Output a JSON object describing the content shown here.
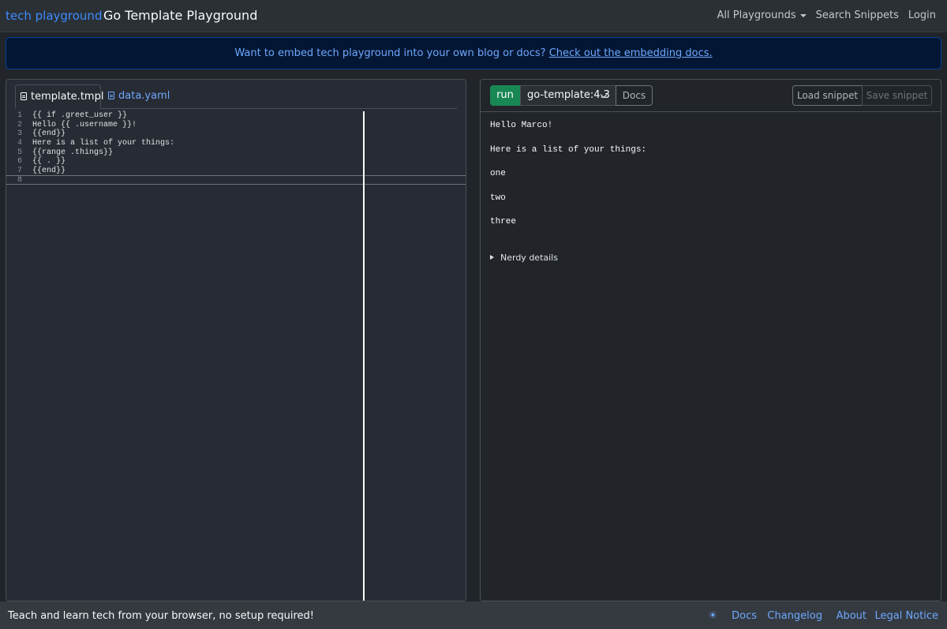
{
  "navbar": {
    "brand": "tech playground",
    "title": "Go Template Playground",
    "menu": {
      "all_playgrounds": "All Playgrounds",
      "search_snippets": "Search Snippets",
      "login": "Login"
    }
  },
  "alert": {
    "text": "Want to embed tech playground into your own blog or docs?",
    "link": "Check out the embedding docs."
  },
  "editor": {
    "tabs": [
      {
        "label": "template.tmpl",
        "active": true,
        "icon": "file-icon"
      },
      {
        "label": "data.yaml",
        "active": false,
        "icon": "file-icon"
      }
    ],
    "lines": [
      {
        "num": "1",
        "text": "{{ if .greet_user }}"
      },
      {
        "num": "2",
        "text": "Hello {{ .username }}!"
      },
      {
        "num": "3",
        "text": "{{end}}"
      },
      {
        "num": "4",
        "text": "Here is a list of your things:"
      },
      {
        "num": "5",
        "text": "{{range .things}}"
      },
      {
        "num": "6",
        "text": "{{ . }}"
      },
      {
        "num": "7",
        "text": "{{end}}"
      },
      {
        "num": "8",
        "text": ""
      }
    ]
  },
  "toolbar": {
    "run_label": "run",
    "engine": "go-template:4.3",
    "docs_label": "Docs",
    "load_label": "Load snippet",
    "save_label": "Save snippet"
  },
  "output": {
    "lines": [
      "Hello Marco!",
      "Here is a list of your things:",
      "one",
      "two",
      "three"
    ],
    "details_label": "Nerdy details"
  },
  "footer": {
    "text": "Teach and learn tech from your browser, no setup required!",
    "theme_icon": "sun-icon",
    "theme_glyph": "☀",
    "links": {
      "docs": "Docs",
      "changelog": "Changelog",
      "about": "About",
      "legal": "Legal Notice"
    }
  },
  "colors": {
    "run": "#198754",
    "link": "#6ea8fe",
    "alert_bg": "#031633"
  }
}
